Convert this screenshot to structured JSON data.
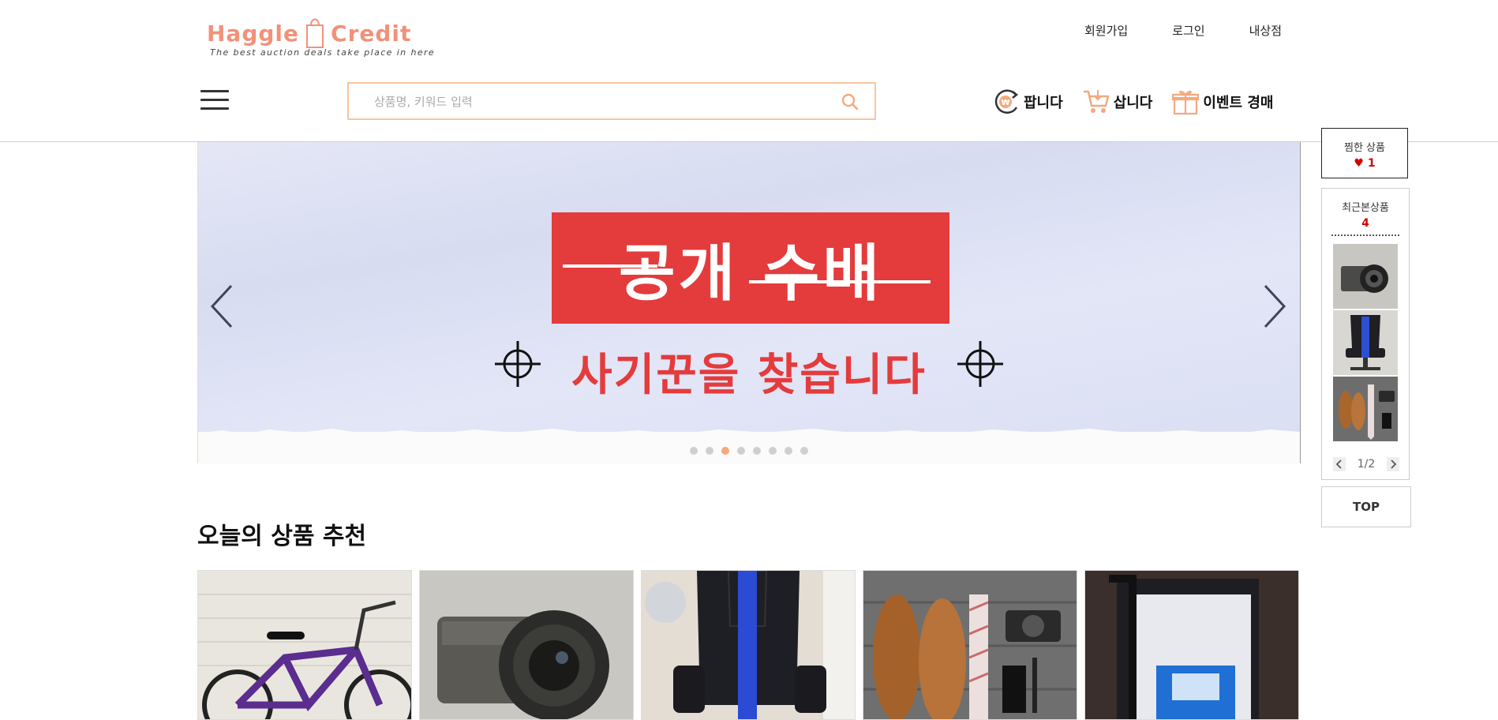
{
  "brand": {
    "name_left": "Haggle",
    "name_right": "Credit",
    "tagline": "The best auction deals take place in here"
  },
  "top_links": [
    "회원가입",
    "로그인",
    "내상점"
  ],
  "search": {
    "placeholder": "상품명, 키워드 입력",
    "value": ""
  },
  "nav": [
    {
      "label": "팝니다",
      "icon": "sell-coin-icon"
    },
    {
      "label": "삽니다",
      "icon": "cart-icon"
    },
    {
      "label": "이벤트 경매",
      "icon": "gift-icon"
    }
  ],
  "banner": {
    "headline": "공개 수배",
    "subtitle": "사기꾼을 찾습니다",
    "slide_count": 8,
    "active_slide": 3
  },
  "side": {
    "favorites_label": "찜한 상품",
    "favorites_count": "1",
    "heart": "♥",
    "recent_label": "최근본상품",
    "recent_count": "4",
    "recent_thumbs": [
      "camera-thumbnail",
      "gaming-chair-thumbnail",
      "shoes-thumbnail"
    ],
    "page_indicator": "1/2",
    "top_label": "TOP"
  },
  "section": {
    "title": "오늘의 상품 추천"
  },
  "products": [
    {
      "image": "purple-bicycle"
    },
    {
      "image": "sony-camera"
    },
    {
      "image": "blue-gaming-chair"
    },
    {
      "image": "brown-shoes-and-camera"
    },
    {
      "image": "printer-machine"
    }
  ],
  "colors": {
    "brand": "#f0927a",
    "search_border": "#f7c49f",
    "banner_red": "#e43b3c",
    "active_dot": "#f4a97d",
    "count_red": "#d40000"
  }
}
